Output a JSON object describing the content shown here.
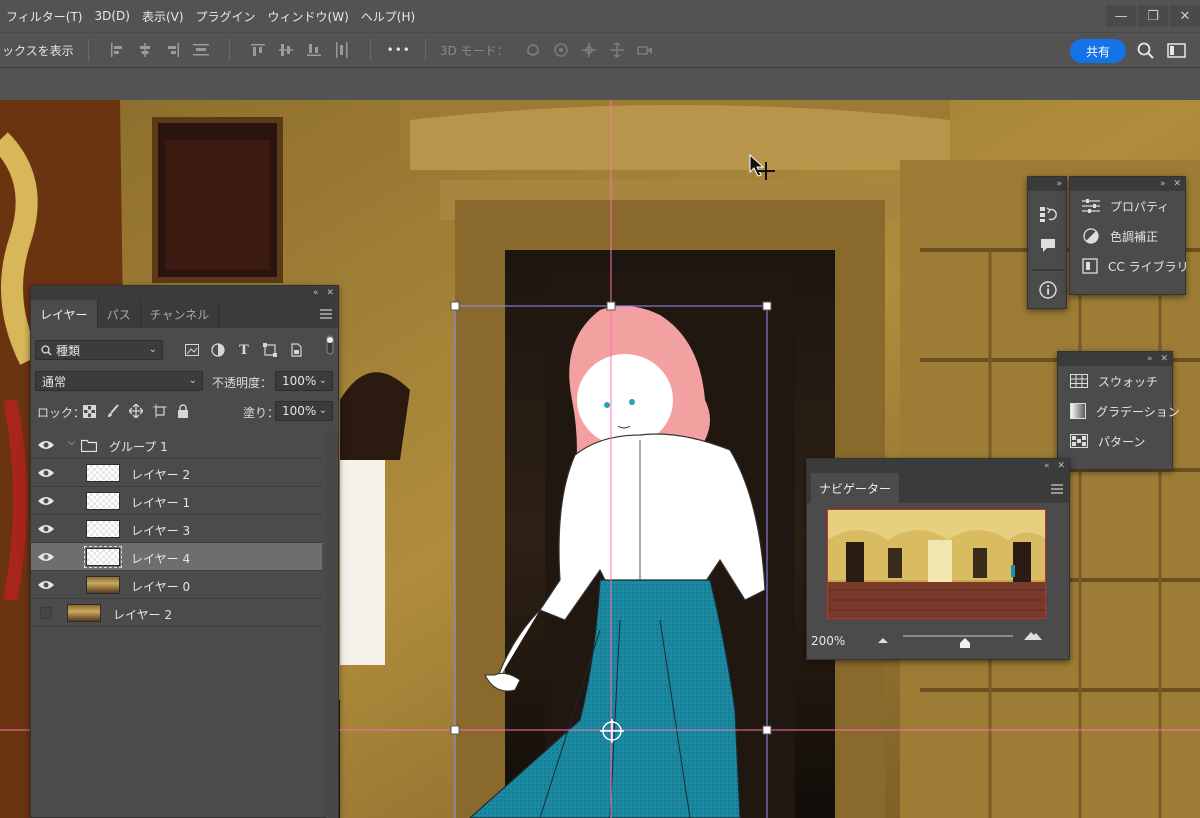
{
  "menu": {
    "items": [
      "フィルター(T)",
      "3D(D)",
      "表示(V)",
      "プラグイン",
      "ウィンドウ(W)",
      "ヘルプ(H)"
    ]
  },
  "window_controls": {
    "minimize": "—",
    "restore": "❐",
    "close": "✕"
  },
  "options": {
    "show_box_label": "ックスを表示",
    "more_label": "•••",
    "mode_3d_label": "3D モード：",
    "share_label": "共有"
  },
  "layers_panel": {
    "tabs": [
      "レイヤー",
      "パス",
      "チャンネル"
    ],
    "filter_kind": "種類",
    "blend_mode": "通常",
    "opacity_label": "不透明度：",
    "opacity_value": "100%",
    "lock_label": "ロック：",
    "fill_label": "塗り：",
    "fill_value": "100%",
    "layers": [
      {
        "name": "グループ 1",
        "visible": true,
        "kind": "group"
      },
      {
        "name": "レイヤー 2",
        "visible": true,
        "kind": "transparent"
      },
      {
        "name": "レイヤー 1",
        "visible": true,
        "kind": "transparent"
      },
      {
        "name": "レイヤー 3",
        "visible": true,
        "kind": "transparent"
      },
      {
        "name": "レイヤー 4",
        "visible": true,
        "kind": "transparent",
        "selected": true
      },
      {
        "name": "レイヤー 0",
        "visible": true,
        "kind": "photo"
      },
      {
        "name": "レイヤー 2",
        "visible": false,
        "kind": "photo"
      }
    ]
  },
  "properties_panel": {
    "items": [
      "プロパティ",
      "色調補正",
      "CC ライブラリ"
    ]
  },
  "swatch_panel": {
    "items": [
      "スウォッチ",
      "グラデーション",
      "パターン"
    ]
  },
  "navigator_panel": {
    "tab": "ナビゲーター",
    "zoom": "200%"
  },
  "colors": {
    "accent": "#1473e6",
    "guide": "#ff6fb0",
    "bbox": "#9b8cff"
  }
}
